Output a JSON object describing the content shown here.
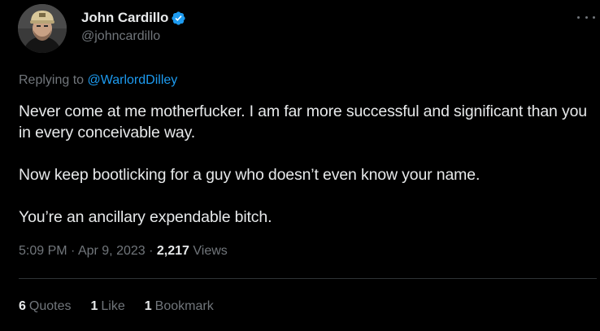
{
  "author": {
    "display_name": "John Cardillo",
    "handle": "@johncardillo",
    "verified_icon": "verified-badge-icon",
    "avatar_icon": "avatar"
  },
  "reply": {
    "prefix": "Replying to ",
    "target": "@WarlordDilley"
  },
  "tweet": {
    "paragraphs": [
      "Never come at me motherfucker. I am far more successful and significant than you in every conceivable way.",
      "Now keep bootlicking for a guy who doesn’t even know your name.",
      "You’re an ancillary expendable bitch."
    ]
  },
  "meta": {
    "time": "5:09 PM",
    "separator": " · ",
    "date": "Apr 9, 2023",
    "views_count": "2,217",
    "views_label": " Views"
  },
  "stats": {
    "quotes_count": "6",
    "quotes_label": "Quotes",
    "likes_count": "1",
    "likes_label": "Like",
    "bookmarks_count": "1",
    "bookmarks_label": "Bookmark"
  },
  "colors": {
    "background": "#000000",
    "text": "#e7e9ea",
    "secondary_text": "#71767b",
    "link": "#1d9bf0",
    "verified": "#1d9bf0",
    "divider": "#2f3336"
  }
}
